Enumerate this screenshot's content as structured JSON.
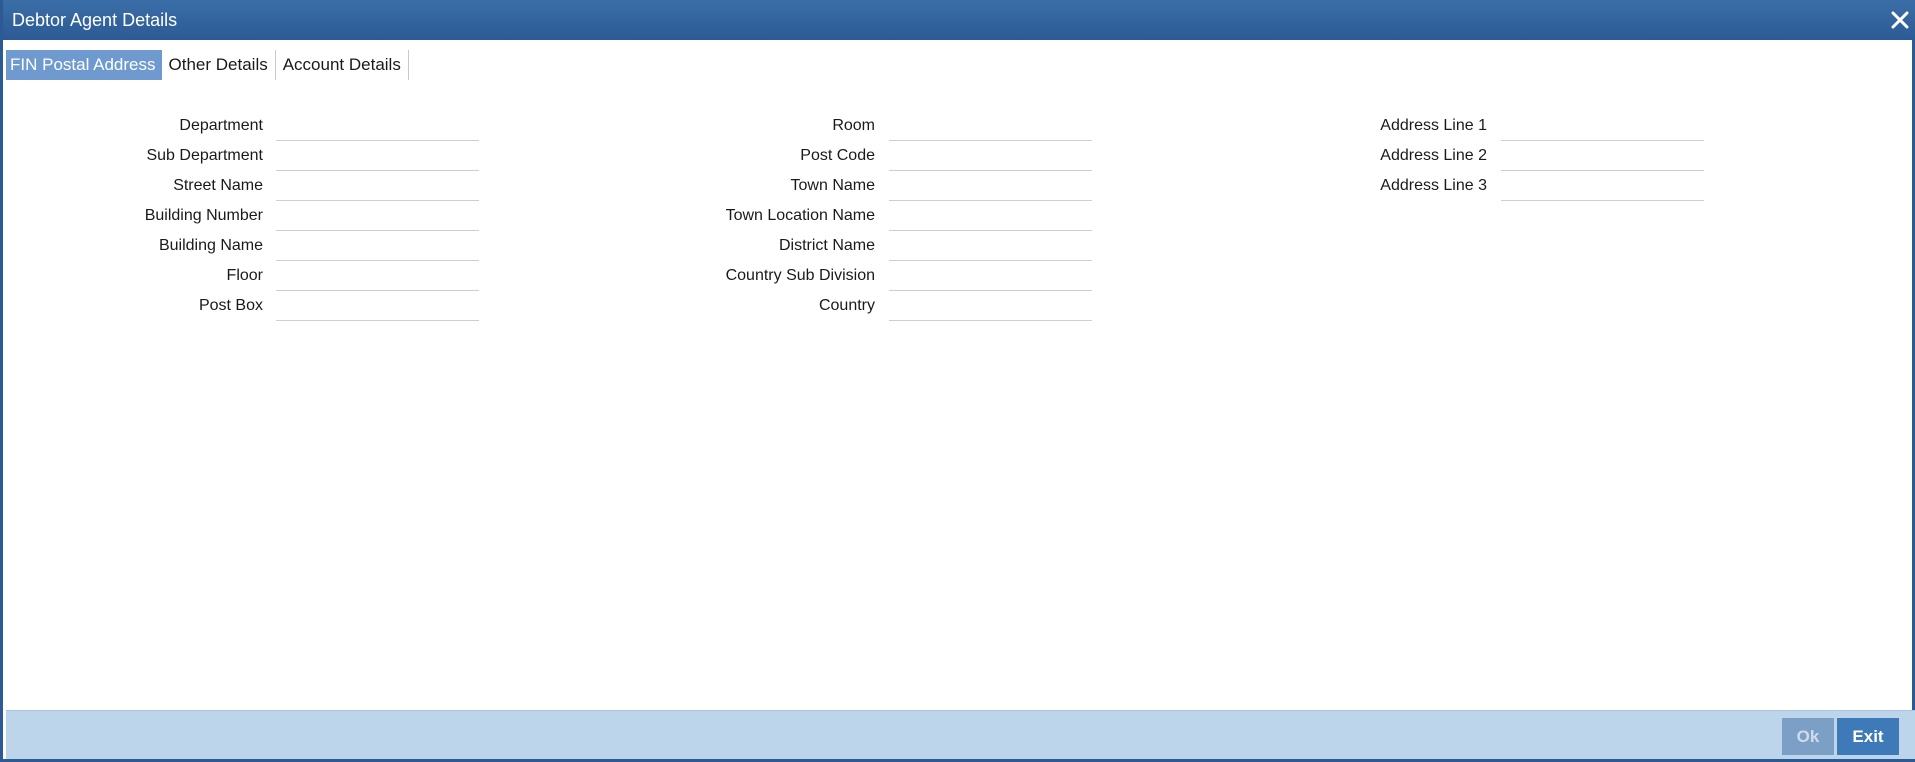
{
  "window": {
    "title": "Debtor Agent Details",
    "close_icon": "close-icon"
  },
  "tabs": [
    {
      "label": "FIN Postal Address",
      "active": true
    },
    {
      "label": "Other Details",
      "active": false
    },
    {
      "label": "Account Details",
      "active": false
    }
  ],
  "form": {
    "department": {
      "label": "Department",
      "value": ""
    },
    "sub_department": {
      "label": "Sub Department",
      "value": ""
    },
    "street_name": {
      "label": "Street Name",
      "value": ""
    },
    "building_number": {
      "label": "Building Number",
      "value": ""
    },
    "building_name": {
      "label": "Building Name",
      "value": ""
    },
    "floor": {
      "label": "Floor",
      "value": ""
    },
    "post_box": {
      "label": "Post Box",
      "value": ""
    },
    "room": {
      "label": "Room",
      "value": ""
    },
    "post_code": {
      "label": "Post Code",
      "value": ""
    },
    "town_name": {
      "label": "Town Name",
      "value": ""
    },
    "town_location_name": {
      "label": "Town Location Name",
      "value": ""
    },
    "district_name": {
      "label": "District Name",
      "value": ""
    },
    "country_sub_division": {
      "label": "Country Sub Division",
      "value": ""
    },
    "country": {
      "label": "Country",
      "value": ""
    },
    "address_line_1": {
      "label": "Address Line 1",
      "value": ""
    },
    "address_line_2": {
      "label": "Address Line 2",
      "value": ""
    },
    "address_line_3": {
      "label": "Address Line 3",
      "value": ""
    }
  },
  "footer": {
    "ok_label": "Ok",
    "exit_label": "Exit"
  },
  "colors": {
    "titlebar": "#2c5a94",
    "active_tab": "#6f9ad0",
    "footer": "#bcd5ea",
    "exit_button": "#3f7ab8"
  }
}
